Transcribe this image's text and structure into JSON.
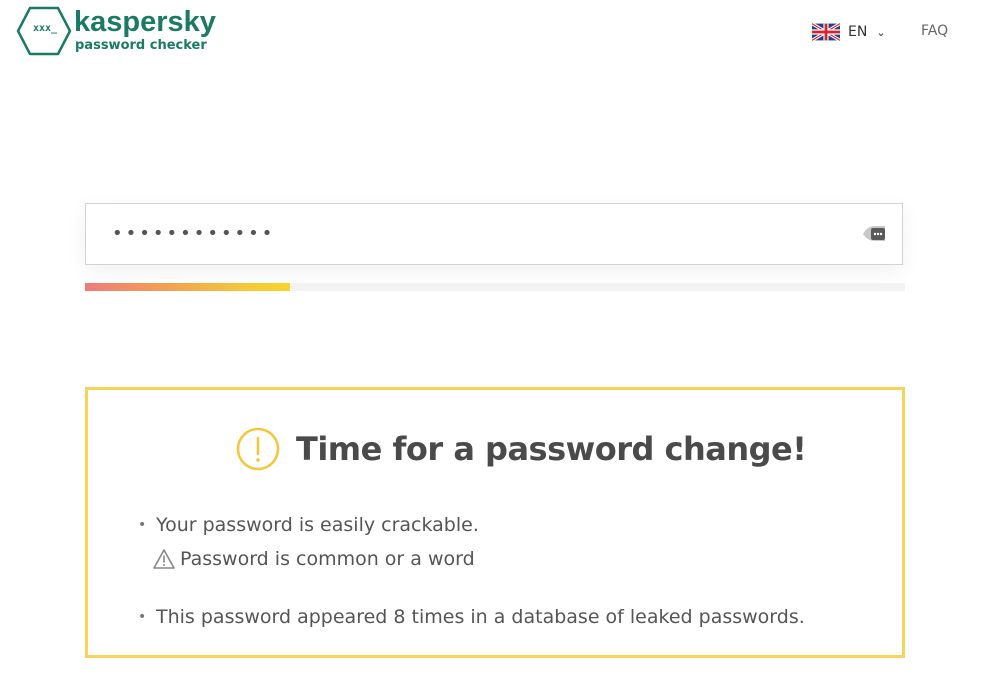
{
  "header": {
    "logo": {
      "icon_text": "xxx_",
      "brand": "kaspersky",
      "subtitle": "password checker"
    },
    "language": {
      "label": "EN",
      "flag_icon": "uk-flag-icon",
      "chevron_icon": "chevron-down-icon"
    },
    "faq_label": "FAQ"
  },
  "password_input": {
    "masked_value": "••••••••••••",
    "visibility_icon": "eye-toggle-icon"
  },
  "strength_meter": {
    "level": 0.25,
    "colors": [
      "#f07c7a",
      "#f8d52b"
    ]
  },
  "result": {
    "icon": "exclamation-circle-icon",
    "title": "Time for a password change!",
    "items": [
      {
        "text": "Your password is easily crackable."
      },
      {
        "text": "This password appeared 8 times in a database of leaked passwords."
      }
    ],
    "sub_item": {
      "icon": "warning-triangle-icon",
      "text": "Password is common or a word"
    }
  },
  "colors": {
    "brand": "#1a7a63",
    "warning_border": "#f7d35a",
    "warning_icon": "#f5c53c"
  }
}
